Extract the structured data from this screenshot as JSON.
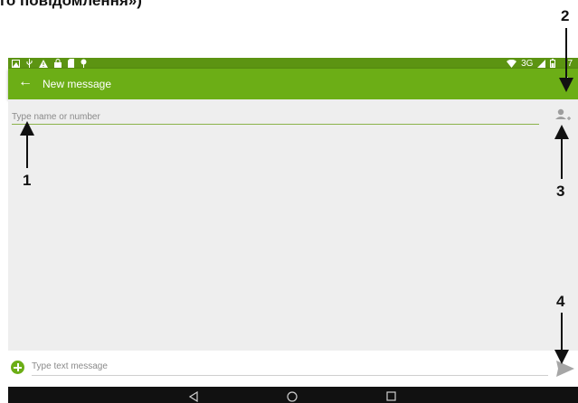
{
  "caption": "го повідомлення»)",
  "status_bar": {
    "icons": [
      "image-notification-icon",
      "usb-icon",
      "warning-icon",
      "lock-icon",
      "sd-card-icon",
      "location-icon"
    ],
    "network": "3G",
    "time": "7"
  },
  "app_bar": {
    "back_icon": "back-arrow-icon",
    "title": "New message",
    "menu_icon": "overflow-menu-icon"
  },
  "recipient": {
    "placeholder": "Type name or number"
  },
  "add_contact_icon": "add-contact-icon",
  "compose": {
    "attach_icon": "add-attachment-icon",
    "placeholder": "Type text message",
    "send_icon": "send-icon"
  },
  "nav_bar": {
    "items": [
      "back",
      "home",
      "recents"
    ]
  },
  "callouts": [
    "1",
    "2",
    "3",
    "4"
  ],
  "colors": {
    "status_bar": "#5c9412",
    "app_bar": "#6cae16",
    "content_bg": "#eeeeee",
    "nav_bar": "#111111"
  }
}
